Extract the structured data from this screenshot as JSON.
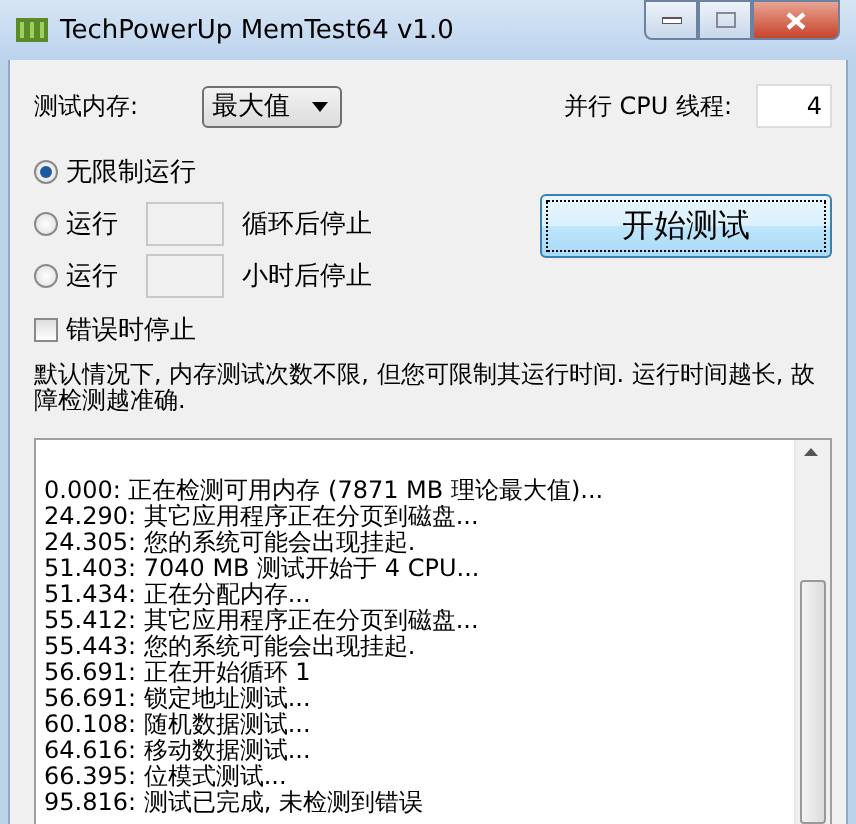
{
  "window": {
    "title": "TechPowerUp MemTest64 v1.0"
  },
  "memory": {
    "label": "测试内存:",
    "value": "最大值"
  },
  "threads": {
    "label": "并行 CPU 线程:",
    "value": "4"
  },
  "run_modes": [
    {
      "kind": "plain",
      "label": "无限制运行",
      "selected": true
    },
    {
      "kind": "field",
      "label": "运行",
      "suffix": "循环后停止",
      "selected": false
    },
    {
      "kind": "field",
      "label": "运行",
      "suffix": "小时后停止",
      "selected": false
    }
  ],
  "stop_on_error": {
    "label": "错误时停止",
    "checked": false
  },
  "start_button": "开始测试",
  "description": "默认情况下, 内存测试次数不限, 但您可限制其运行时间. 运行时间越长, 故障检测越准确.",
  "log": [
    "0.000: 正在检测可用内存 (7871 MB 理论最大值)...",
    "24.290: 其它应用程序正在分页到磁盘...",
    "24.305: 您的系统可能会出现挂起.",
    "51.403: 7040 MB 测试开始于 4 CPU...",
    "51.434: 正在分配内存...",
    "55.412: 其它应用程序正在分页到磁盘...",
    "55.443: 您的系统可能会出现挂起.",
    "56.691: 正在开始循环 1",
    "56.691: 锁定地址测试...",
    "60.108: 随机数据测试...",
    "64.616: 移动数据测试...",
    "66.395: 位模式测试...",
    "95.816: 测试已完成, 未检测到错误"
  ]
}
